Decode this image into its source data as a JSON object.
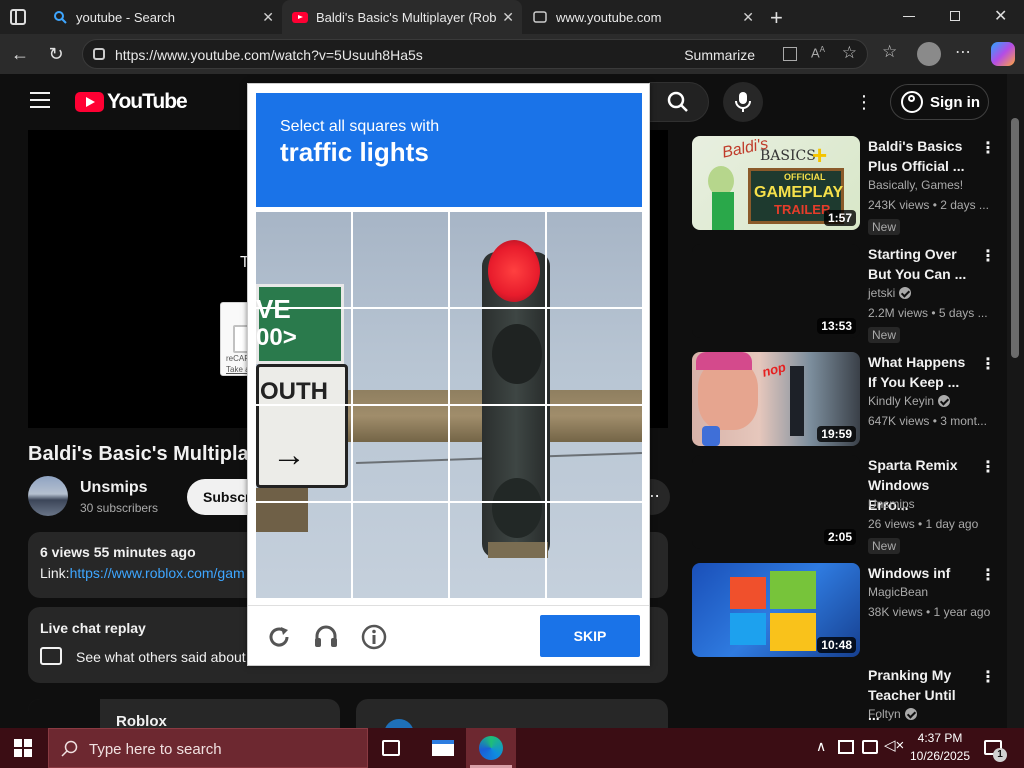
{
  "browser": {
    "tabs": [
      {
        "title": "youtube - Search"
      },
      {
        "title": "Baldi's Basic's Multiplayer (Roblox"
      },
      {
        "title": "www.youtube.com"
      }
    ],
    "url": "https://www.youtube.com/watch?v=5Usuuh8Ha5s",
    "summarize_label": "Summarize"
  },
  "youtube": {
    "logo_text": "YouTube",
    "signin_label": "Sign in",
    "player_text": "To c",
    "recaptcha_label": "reCAPTCHA",
    "recaptcha_action": "Take action",
    "video_title": "Baldi's Basic's Multiplayer",
    "channel": {
      "name": "Unsmips",
      "subs": "30 subscribers",
      "subscribe_label": "Subscr"
    },
    "description": {
      "meta": "6 views  55 minutes ago",
      "link_prefix": "Link:",
      "link_text": "https://www.roblox.com/gam"
    },
    "chat": {
      "title": "Live chat replay",
      "text": "See what others said about"
    },
    "card_title": "Roblox",
    "recommendations": [
      {
        "title": "Baldi's Basics Plus Official ...",
        "channel": "Basically, Games!",
        "verified": false,
        "stats": "243K views • 2 days ...",
        "new": "New",
        "duration": "1:57",
        "thumb_title": "Baldi's",
        "thumb_plus": "BASICS",
        "thumb_gameplay": "GAMEPLAY",
        "thumb_official": "OFFICIAL",
        "thumb_trailer": "TRAILER"
      },
      {
        "title": "Starting Over But You Can ...",
        "channel": "jetski",
        "verified": true,
        "stats": "2.2M views • 5 days ...",
        "new": "New",
        "duration": "13:53"
      },
      {
        "title": "What Happens If You Keep ...",
        "channel": "Kindly Keyin",
        "verified": true,
        "stats": "647K views • 3 mont...",
        "new": "",
        "duration": "19:59",
        "thumb_text": "nop"
      },
      {
        "title": "Sparta Remix Windows Erro...",
        "channel": "Unsmips",
        "verified": false,
        "stats": "26 views • 1 day ago",
        "new": "New",
        "duration": "2:05"
      },
      {
        "title": "Windows inf",
        "channel": "MagicBean",
        "verified": false,
        "stats": "38K views • 1 year ago",
        "new": "",
        "duration": "10:48"
      },
      {
        "title": "Pranking My Teacher Until ...",
        "channel": "Foltyn",
        "verified": true,
        "stats": "",
        "new": "",
        "duration": ""
      }
    ]
  },
  "captcha": {
    "instruction": "Select all squares with",
    "target": "traffic lights",
    "skip_label": "SKIP",
    "sign_line1": "VE",
    "sign_line2": "00>",
    "sign_south": "OUTH"
  },
  "taskbar": {
    "search_placeholder": "Type here to search",
    "time": "4:37 PM",
    "date": "10/26/2025",
    "notification_count": "1"
  },
  "colors": {
    "youtube_red": "#ff0033",
    "captcha_blue": "#1a73e8",
    "taskbar_bg": "#3b0d14"
  }
}
